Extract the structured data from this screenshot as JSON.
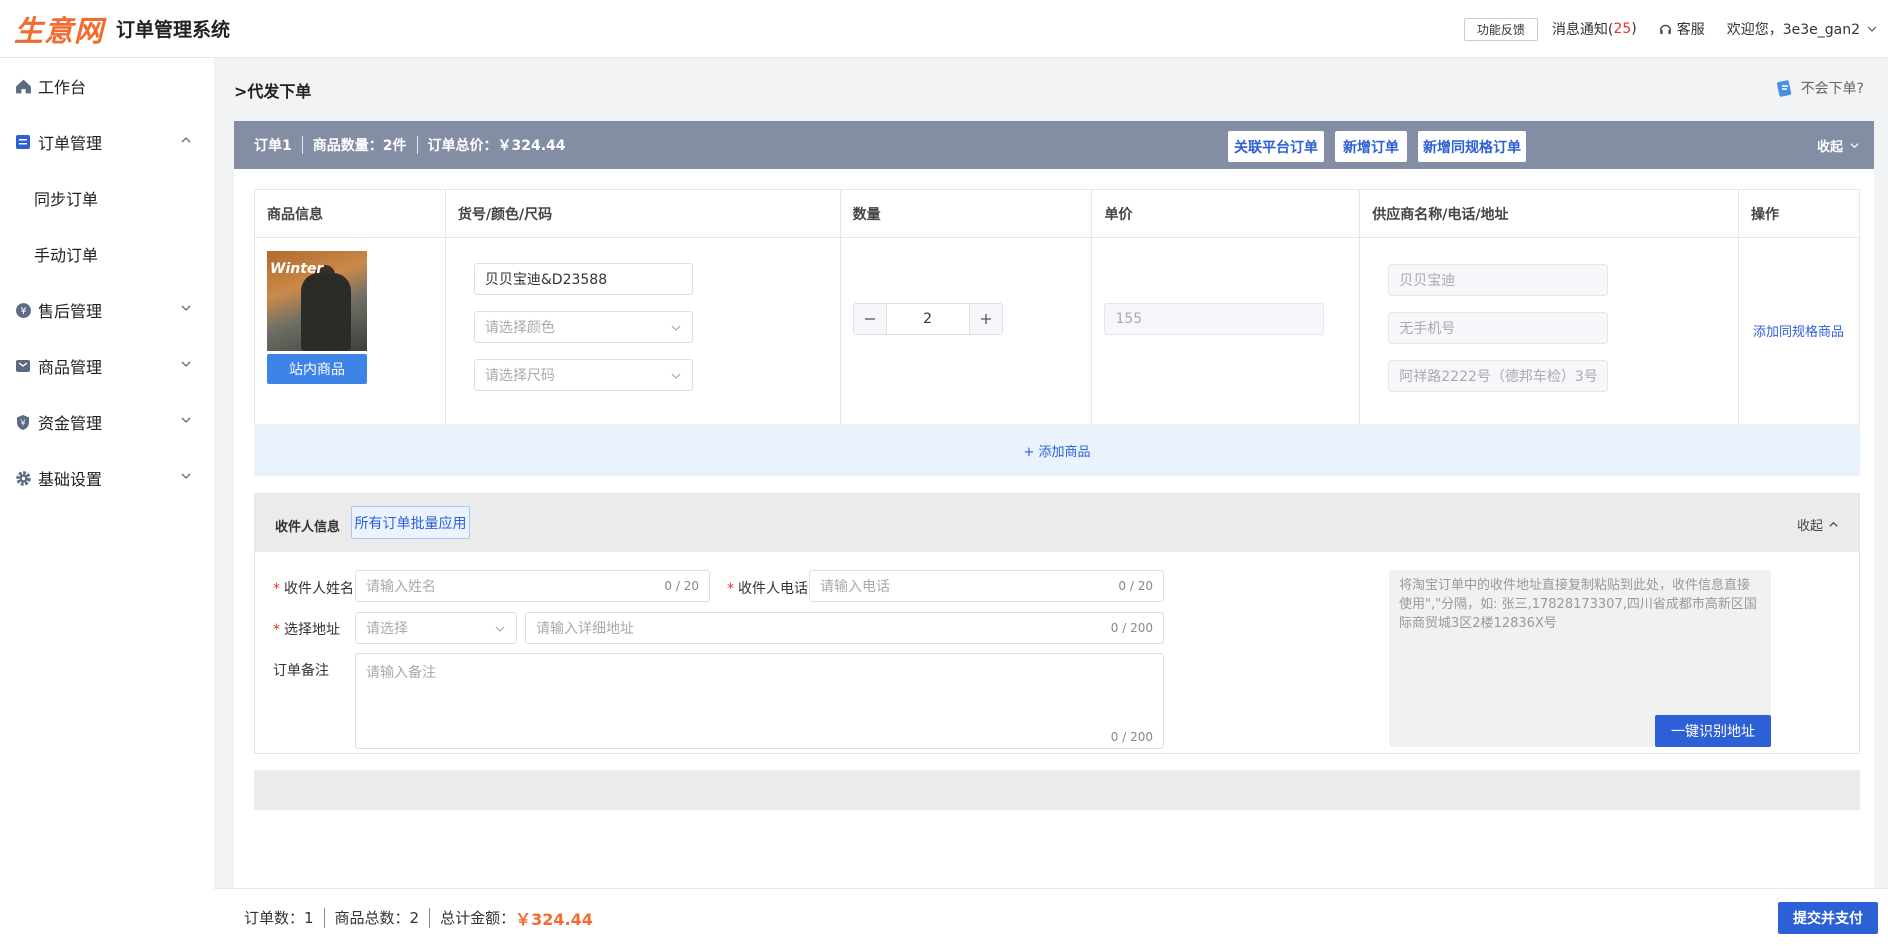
{
  "header": {
    "logo_text": "生意网",
    "app_title": "订单管理系统",
    "feedback_label": "功能反馈",
    "notice_label": "消息通知(",
    "notice_count": "25",
    "notice_close": ")",
    "service_label": "客服",
    "welcome_label": "欢迎您，3e3e_gan2"
  },
  "sidebar": {
    "items": [
      {
        "label": "工作台",
        "icon": "home-icon"
      },
      {
        "label": "订单管理",
        "icon": "order-icon",
        "expanded": true,
        "children": [
          {
            "label": "同步订单"
          },
          {
            "label": "手动订单"
          }
        ]
      },
      {
        "label": "售后管理",
        "icon": "aftersale-icon"
      },
      {
        "label": "商品管理",
        "icon": "goods-icon"
      },
      {
        "label": "资金管理",
        "icon": "fund-icon"
      },
      {
        "label": "基础设置",
        "icon": "gear-icon"
      }
    ]
  },
  "page": {
    "title": ">代发下单",
    "help_label": "不会下单?"
  },
  "order": {
    "name": "订单1",
    "qty_summary": "商品数量：2件",
    "total_summary": "订单总价：￥324.44",
    "link_platform_label": "关联平台订单",
    "add_order_label": "新增订单",
    "add_same_spec_label": "新增同规格订单",
    "collapse_label": "收起"
  },
  "product_table": {
    "headers": [
      "商品信息",
      "货号/颜色/尺码",
      "数量",
      "单价",
      "供应商名称/电话/地址",
      "操作"
    ],
    "rows": [
      {
        "image_text": "Winter",
        "tag": "站内商品",
        "sku": "贝贝宝迪&D23588",
        "color_placeholder": "请选择颜色",
        "size_placeholder": "请选择尺码",
        "quantity": "2",
        "unit_price": "155",
        "supplier_name": "贝贝宝迪",
        "supplier_phone": "无手机号",
        "supplier_address": "阿祥路2222号（德邦车检）3号",
        "action": "添加同规格商品"
      }
    ],
    "add_product_label": "+ 添加商品"
  },
  "receiver": {
    "title": "收件人信息",
    "batch_apply_label": "所有订单批量应用",
    "collapse_label": "收起",
    "name_label": "收件人姓名",
    "name_placeholder": "请输入姓名",
    "name_count": "0 / 20",
    "phone_label": "收件人电话",
    "phone_placeholder": "请输入电话",
    "phone_count": "0 / 20",
    "address_label": "选择地址",
    "address_select_placeholder": "请选择",
    "address_detail_placeholder": "请输入详细地址",
    "address_count": "0 / 200",
    "remark_label": "订单备注",
    "remark_placeholder": "请输入备注",
    "remark_count": "0 / 200",
    "paste_placeholder": "将淘宝订单中的收件地址直接复制粘贴到此处，收件信息直接使用\",\"分隔，如: 张三,17828173307,四川省成都市高新区国际商贸城3区2楼12836X号",
    "parse_button_label": "一键识别地址"
  },
  "footer": {
    "order_count": "订单数：1",
    "goods_count": "商品总数：2",
    "total_label": "总计金额：",
    "total_amount": "￥324.44",
    "submit_label": "提交并支付"
  },
  "colors": {
    "brand": "#f26b2f",
    "primary": "#2d5fd6",
    "order_header": "#838ea5",
    "danger": "#e0362c"
  }
}
